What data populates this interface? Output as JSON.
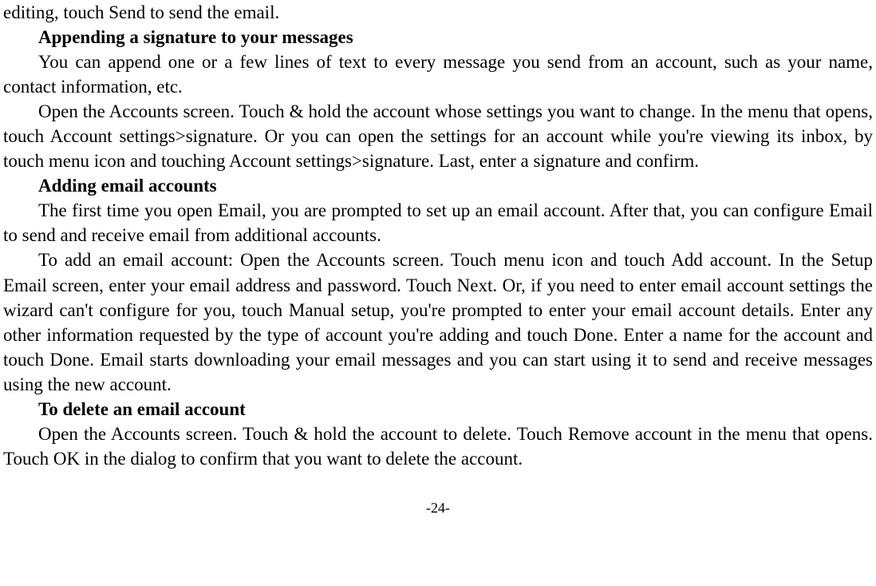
{
  "p0": "editing, touch Send to send the email.",
  "h1": "Appending a signature to your messages",
  "p1": "You can append one or a few lines of text to every message you send from an account, such as your name, contact information, etc.",
  "p2": "Open the Accounts screen. Touch & hold the account whose settings you want to change. In the menu that opens, touch Account settings>signature. Or you can open the settings for an account while you're viewing its inbox, by touch menu icon and touching Account settings>signature. Last, enter a signature and confirm.",
  "h2": "Adding email accounts",
  "p3": "The first time you open Email, you are prompted to set up an email account. After that, you can configure Email to send and receive email from additional accounts.",
  "p4": "To add an email account: Open the Accounts screen. Touch menu icon and touch Add account. In the Setup Email screen, enter your email address and password. Touch Next. Or, if you need to enter email account settings the wizard can't configure for you, touch Manual setup, you're prompted to enter your email account details. Enter any other information requested by the type of account you're adding and touch Done. Enter a name for the account and touch Done. Email starts downloading your email messages and you can start using it to send and receive messages using the new account.",
  "h3": "To delete an email account",
  "p5": "Open the Accounts screen. Touch & hold the account to delete. Touch Remove account in the menu that opens. Touch OK in the dialog to confirm that you want to delete the account.",
  "pagenum": "-24-"
}
